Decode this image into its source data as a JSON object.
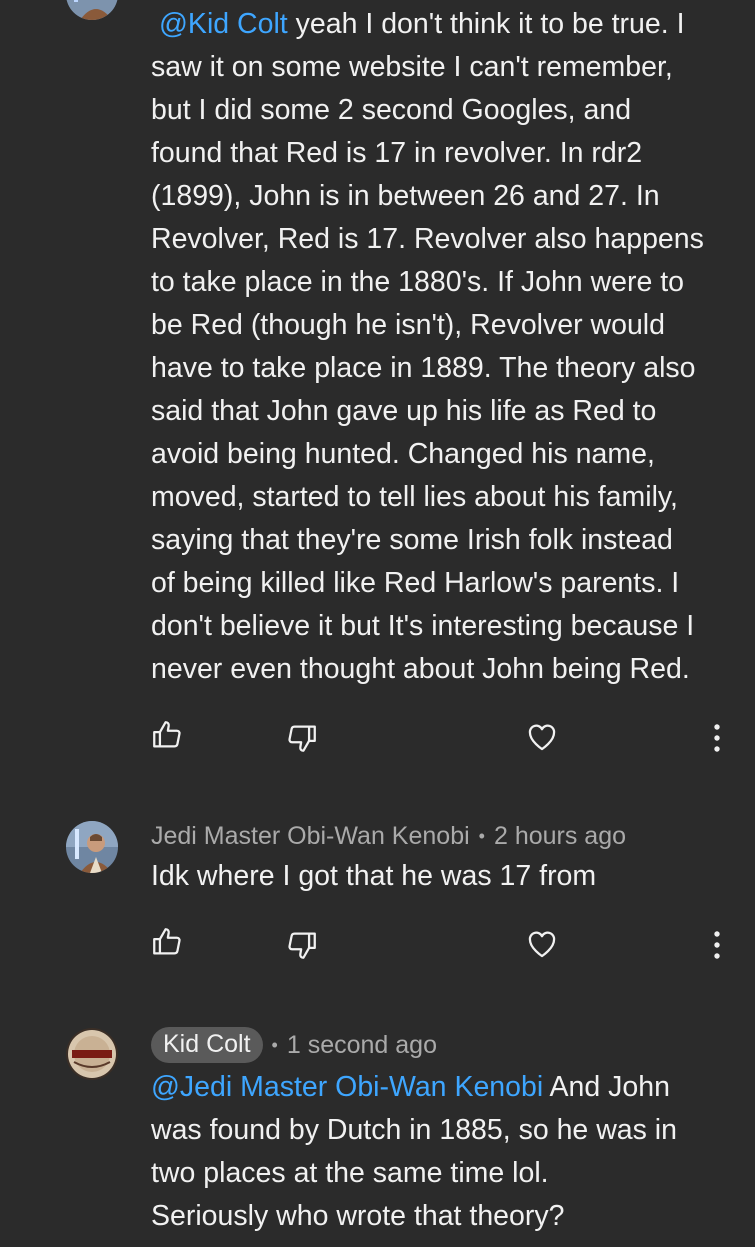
{
  "comments": [
    {
      "author": "",
      "time": "",
      "mention": "@Kid Colt",
      "text": " yeah I don't think it to be true. I\nsaw it on some website I can't remember,\nbut I did some 2 second Googles, and\nfound that Red is 17 in revolver. In rdr2\n(1899), John is in between 26 and 27. In\nRevolver, Red is 17. Revolver also happens\nto take place in the 1880's. If John were to\nbe Red (though he isn't), Revolver would\nhave to take place in 1889. The theory also\nsaid that John gave up his life as Red to\navoid being hunted. Changed his name,\nmoved, started to tell lies about his family,\nsaying that they're some Irish folk instead\nof being killed like Red Harlow's parents. I\ndon't believe it but It's interesting because I\nnever even thought about John being Red."
    },
    {
      "author": "Jedi Master Obi-Wan Kenobi",
      "separator": "•",
      "time": "2 hours ago",
      "text": "Idk where I got that he was 17 from"
    },
    {
      "author": "Kid Colt",
      "separator": "•",
      "time": "1 second ago",
      "mention": "@Jedi Master Obi-Wan Kenobi",
      "text": " And John\nwas found by Dutch in 1885, so he was in\ntwo places at the same time lol.\nSeriously who wrote that theory?"
    }
  ],
  "icons": {
    "like": "thumbs-up-icon",
    "dislike": "thumbs-down-icon",
    "heart": "heart-icon",
    "more": "more-vert-icon"
  },
  "colors": {
    "background": "#2b2b2b",
    "text": "#f1f1f1",
    "meta": "#aaaaaa",
    "mention": "#3ea6ff",
    "chip": "#5a5a5a"
  }
}
